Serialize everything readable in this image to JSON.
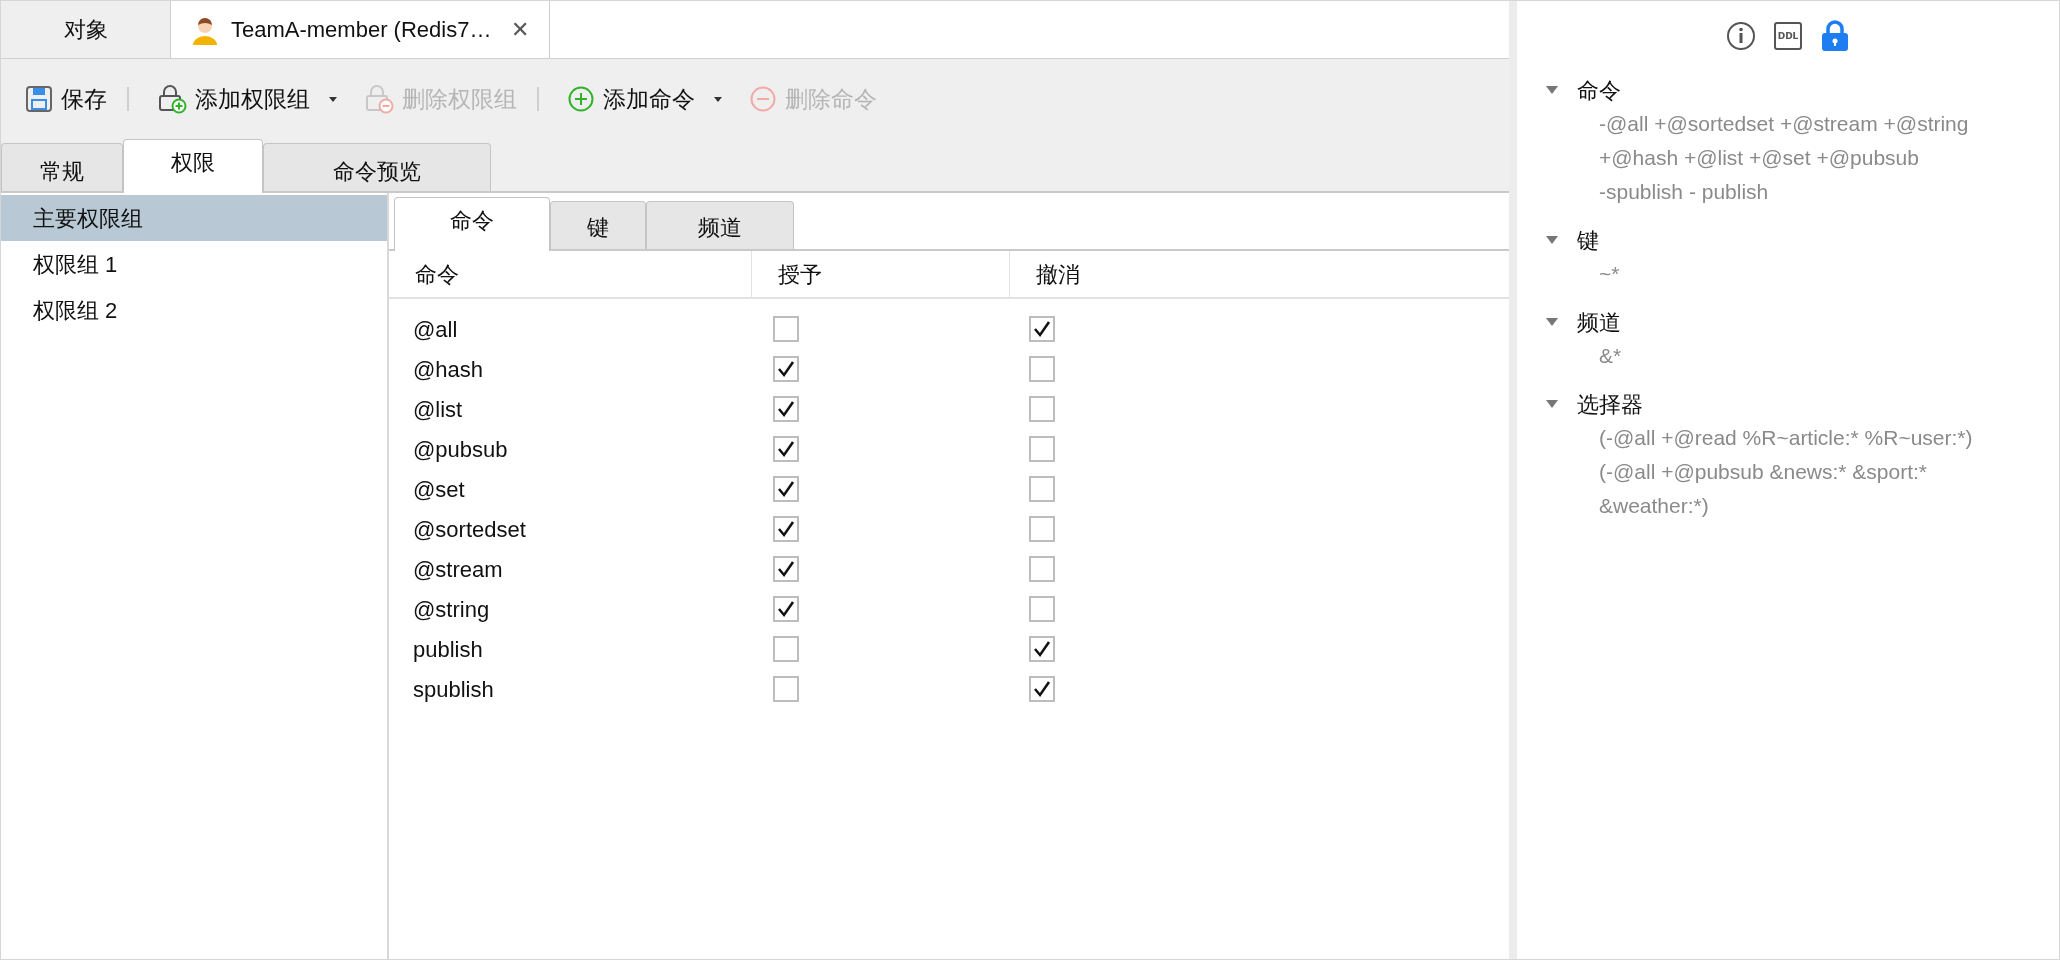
{
  "document_tabs": [
    {
      "label": "对象",
      "kind": "plain",
      "selected": false
    },
    {
      "label": "TeamA-member (Redis7…",
      "kind": "user",
      "selected": true,
      "close": "✕"
    }
  ],
  "toolbar": [
    {
      "label": "保存",
      "kind": "save",
      "disabled": false,
      "menu": false
    },
    {
      "kind": "separator"
    },
    {
      "label": "添加权限组",
      "kind": "add-group",
      "disabled": false,
      "menu": true
    },
    {
      "label": "删除权限组",
      "kind": "remove-group",
      "disabled": true,
      "menu": false
    },
    {
      "kind": "separator"
    },
    {
      "label": "添加命令",
      "kind": "add",
      "disabled": false,
      "menu": true
    },
    {
      "label": "删除命令",
      "kind": "remove",
      "disabled": true,
      "menu": false
    }
  ],
  "section_tabs": [
    {
      "label": "常规",
      "selected": false
    },
    {
      "label": "权限",
      "selected": true
    },
    {
      "label": "命令预览",
      "selected": false
    }
  ],
  "groups": [
    {
      "label": "主要权限组",
      "selected": true
    },
    {
      "label": "权限组 1",
      "selected": false
    },
    {
      "label": "权限组 2",
      "selected": false
    }
  ],
  "permission_tabs": [
    {
      "label": "命令",
      "selected": true
    },
    {
      "label": "键",
      "selected": false
    },
    {
      "label": "频道",
      "selected": false
    }
  ],
  "table": {
    "columns": [
      "命令",
      "授予",
      "撤消"
    ],
    "rows": [
      {
        "command": "@all",
        "grant": false,
        "revoke": true
      },
      {
        "command": "@hash",
        "grant": true,
        "revoke": false
      },
      {
        "command": "@list",
        "grant": true,
        "revoke": false
      },
      {
        "command": "@pubsub",
        "grant": true,
        "revoke": false
      },
      {
        "command": "@set",
        "grant": true,
        "revoke": false
      },
      {
        "command": "@sortedset",
        "grant": true,
        "revoke": false
      },
      {
        "command": "@stream",
        "grant": true,
        "revoke": false
      },
      {
        "command": "@string",
        "grant": true,
        "revoke": false
      },
      {
        "command": "publish",
        "grant": false,
        "revoke": true
      },
      {
        "command": "spublish",
        "grant": false,
        "revoke": true
      }
    ]
  },
  "side_panel": {
    "icons": [
      {
        "kind": "info",
        "selected": false
      },
      {
        "kind": "ddl",
        "label": "DDL",
        "selected": false
      },
      {
        "kind": "lock",
        "selected": true
      }
    ],
    "sections": [
      {
        "title": "命令",
        "expanded": true,
        "lines": [
          "-@all +@sortedset +@stream +@string",
          "+@hash +@list +@set +@pubsub",
          "-spublish - publish"
        ]
      },
      {
        "title": "键",
        "expanded": true,
        "lines": [
          "~*"
        ]
      },
      {
        "title": "频道",
        "expanded": true,
        "lines": [
          "&*"
        ]
      },
      {
        "title": "选择器",
        "expanded": true,
        "lines": [
          "(-@all +@read %R~article:* %R~user:*)",
          "(-@all +@pubsub &news:* &sport:*",
          "&weather:*)"
        ]
      }
    ]
  }
}
